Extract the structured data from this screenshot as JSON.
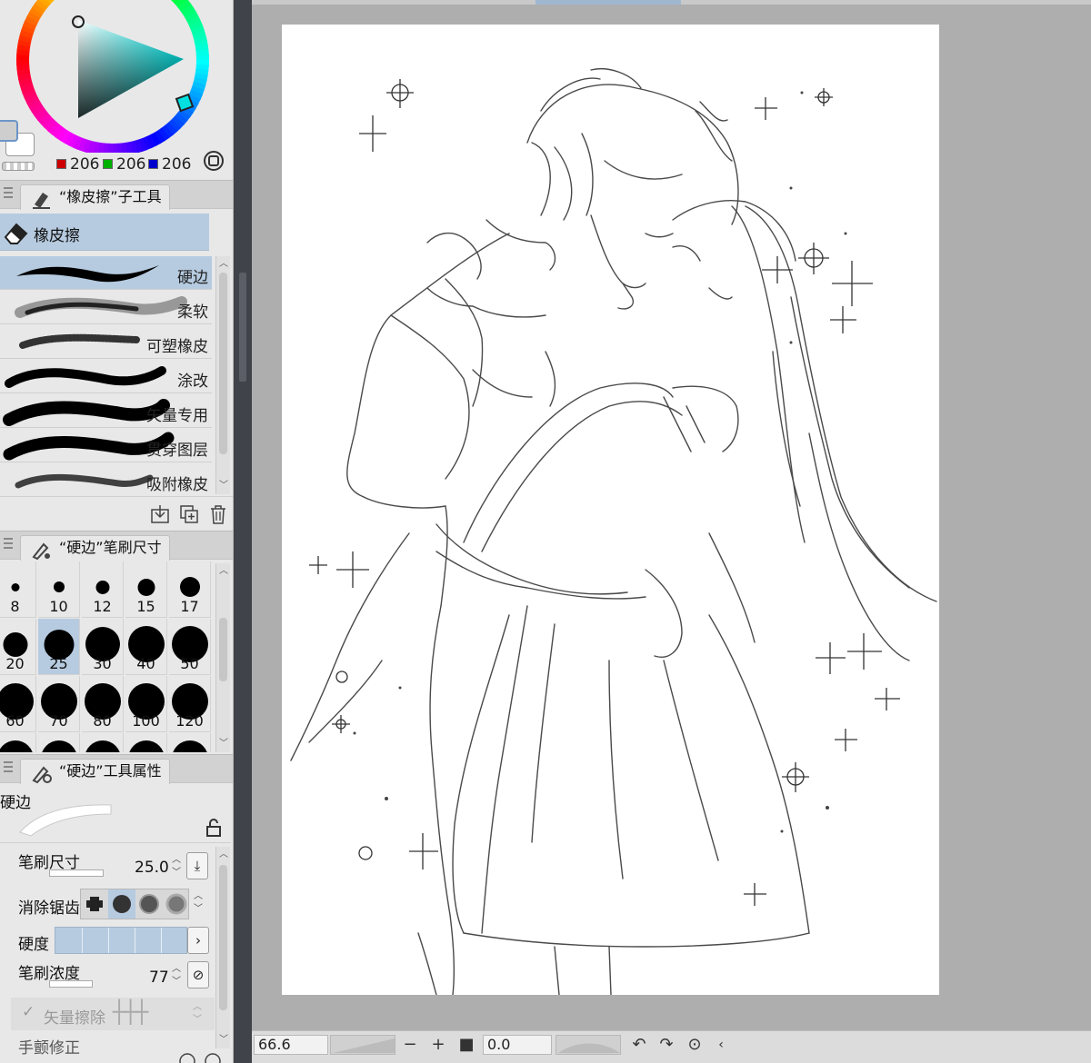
{
  "color": {
    "r_value": "206",
    "g_value": "206",
    "b_value": "206",
    "r_swatch": "#cc0000",
    "g_swatch": "#00b000",
    "b_swatch": "#0000cc",
    "main_color": "#cecece",
    "sub_color": "#ffffff"
  },
  "subtool_panel": {
    "tab_label": "“橡皮擦”子工具",
    "group_label": "橡皮擦",
    "items": [
      {
        "label": "硬边",
        "selected": true
      },
      {
        "label": "柔软",
        "selected": false
      },
      {
        "label": "可塑橡皮",
        "selected": false
      },
      {
        "label": "涂改",
        "selected": false
      },
      {
        "label": "矢量专用",
        "selected": false
      },
      {
        "label": "贯穿图层",
        "selected": false
      },
      {
        "label": "吸附橡皮",
        "selected": false
      }
    ]
  },
  "brush_size_panel": {
    "tab_label": "“硬边”笔刷尺寸",
    "sizes": [
      "8",
      "10",
      "12",
      "15",
      "17",
      "20",
      "25",
      "30",
      "40",
      "50",
      "60",
      "70",
      "80",
      "100",
      "120"
    ],
    "selected": "25"
  },
  "tool_property_panel": {
    "tab_label": "“硬边”工具属性",
    "preset_name": "硬边",
    "brush_size_label": "笔刷尺寸",
    "brush_size_value": "25.0",
    "antialias_label": "消除锯齿",
    "hardness_label": "硬度",
    "density_label": "笔刷浓度",
    "density_value": "77",
    "vector_erase_label": "矢量擦除",
    "stabilization_label": "手颤修正"
  },
  "statusbar": {
    "zoom_value": "66.6",
    "rotation_value": "0.0"
  }
}
